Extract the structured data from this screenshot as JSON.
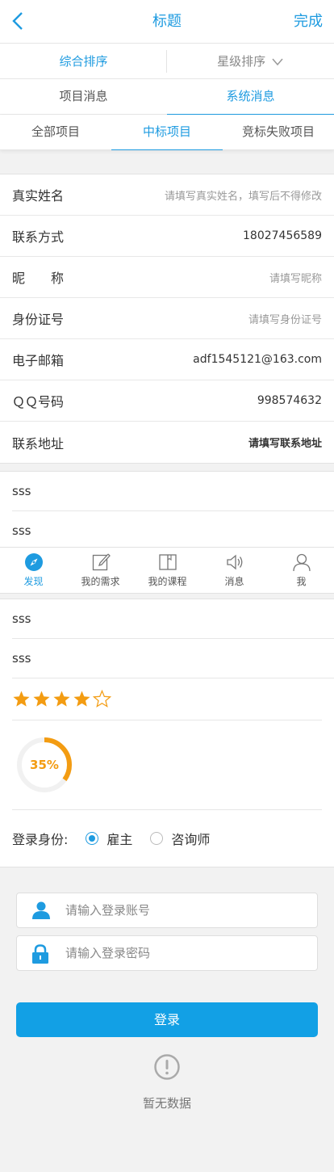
{
  "header": {
    "back_icon": "chevron-left-icon",
    "title": "标题",
    "done_label": "完成"
  },
  "sort": {
    "comprehensive": "综合排序",
    "star": "星级排序",
    "star_icon": "chevron-down-icon"
  },
  "message_tabs": [
    {
      "label": "项目消息",
      "active": false
    },
    {
      "label": "系统消息",
      "active": true
    }
  ],
  "project_tabs": [
    {
      "label": "全部项目",
      "active": false
    },
    {
      "label": "中标项目",
      "active": true
    },
    {
      "label": "竞标失败项目",
      "active": false
    }
  ],
  "form": {
    "real_name": {
      "label": "真实姓名",
      "placeholder": "请填写真实姓名，填写后不得修改"
    },
    "contact": {
      "label": "联系方式",
      "value": "18027456589"
    },
    "nickname": {
      "label": "昵　　称",
      "placeholder": "请填写昵称"
    },
    "id_number": {
      "label": "身份证号",
      "placeholder": "请填写身份证号"
    },
    "email": {
      "label": "电子邮箱",
      "value": "adf1545121@163.com"
    },
    "qq": {
      "label": "ＱＱ号码",
      "value": "998574632"
    },
    "address": {
      "label": "联系地址",
      "value": "请填写联系地址"
    }
  },
  "list1": [
    "sss",
    "sss"
  ],
  "tabbar": [
    {
      "label": "发现",
      "icon": "compass-icon",
      "active": true
    },
    {
      "label": "我的需求",
      "icon": "edit-icon",
      "active": false
    },
    {
      "label": "我的课程",
      "icon": "book-icon",
      "active": false
    },
    {
      "label": "消息",
      "icon": "speaker-icon",
      "active": false
    },
    {
      "label": "我",
      "icon": "user-icon",
      "active": false
    }
  ],
  "list2": [
    "sss",
    "sss"
  ],
  "rating": {
    "value": 4,
    "max": 5,
    "color": "#f39c12"
  },
  "progress": {
    "value": 0.35,
    "label": "35%",
    "color": "#f39c12"
  },
  "identity": {
    "label": "登录身份:",
    "options": [
      {
        "label": "雇主",
        "selected": true
      },
      {
        "label": "咨询师",
        "selected": false
      }
    ]
  },
  "login": {
    "account_placeholder": "请输入登录账号",
    "account_icon": "user-icon",
    "password_placeholder": "请输入登录密码",
    "password_icon": "lock-icon",
    "button": "登录",
    "accent": "#12a0e5"
  },
  "empty": {
    "icon": "exclamation-icon",
    "text": "暂无数据"
  }
}
